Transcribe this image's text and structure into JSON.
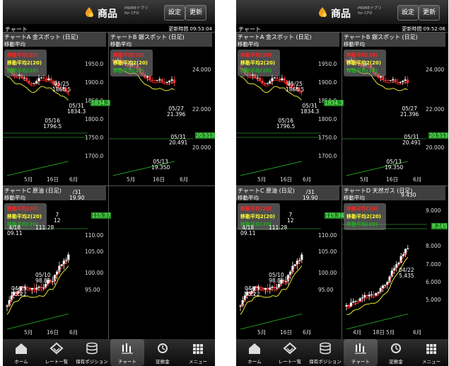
{
  "screens": [
    {
      "header": {
        "title": "商品",
        "sub1": "PRIMEナブリ",
        "sub2": "for CFD",
        "settings_label": "設定",
        "refresh_label": "更新"
      },
      "tab_title": "チャート",
      "updated": "更新時間 09:53:04",
      "panels": [
        {
          "title": "チャートA 金スポット (日足)",
          "subtitle": "移動平均",
          "legend": [
            "移動平均(20)",
            "移動平均2(20)",
            "移動平均(20)"
          ],
          "yticks": [
            "1950.0",
            "1900.0",
            "1850.0",
            "1800.0",
            "1750.0",
            "1700.0"
          ],
          "xticks": [
            "5月",
            "16日",
            "6月"
          ],
          "current": "1834.3",
          "annotations": [
            {
              "text": "05/25\n1866.5"
            },
            {
              "text": "05/31\n1834.3"
            },
            {
              "text": "05/16\n1796.5"
            }
          ]
        },
        {
          "title": "チャートB 銀スポット (日足)",
          "subtitle": "移動平均",
          "legend": [
            "移動平均(20)",
            "移動平均2(20)",
            "移動平均(20)"
          ],
          "yticks": [
            "24.000",
            "22.000",
            "20.000"
          ],
          "xticks": [
            "5月",
            "16日",
            "6月"
          ],
          "current": "20.513",
          "annotations": [
            {
              "text": "05/27\n21.396"
            },
            {
              "text": "05/31\n20.491"
            },
            {
              "text": "05/13\n19.350"
            }
          ]
        },
        {
          "title": "チャートC 原油 (日足)",
          "subtitle": "移動平均",
          "legend": [
            "移動平均(20)",
            "移動平均2(20)",
            "移動平均(20)"
          ],
          "yticks": [
            "110.00",
            "105.00",
            "100.00",
            "95.00"
          ],
          "xticks": [
            "5月",
            "16日",
            "6月"
          ],
          "current": "115.37",
          "annotations": [
            {
              "text": "/31\n19.90"
            },
            {
              "text": "7\n12"
            },
            {
              "text": "4/18\n09.11"
            },
            {
              "text": "111.28"
            },
            {
              "text": "05/10\n98.86"
            },
            {
              "text": "04/25\n95.22"
            }
          ]
        },
        {
          "title": "",
          "subtitle": "",
          "legend": [],
          "yticks": [],
          "xticks": [],
          "current": "",
          "annotations": []
        }
      ]
    },
    {
      "header": {
        "title": "商品",
        "sub1": "PRIMEナブリ",
        "sub2": "for CFD",
        "settings_label": "設定",
        "refresh_label": "更新"
      },
      "tab_title": "チャート",
      "updated": "更新時間 09:52:06",
      "panels": [
        {
          "title": "チャートA 金スポット (日足)",
          "subtitle": "移動平均",
          "legend": [
            "移動平均(20)",
            "移動平均2(20)",
            "移動平均(20)"
          ],
          "yticks": [
            "1950.0",
            "1900.0",
            "1850.0",
            "1800.0",
            "1750.0",
            "1700.0"
          ],
          "xticks": [
            "5月",
            "16日",
            "6月"
          ],
          "current": "1834.3",
          "annotations": [
            {
              "text": "05/25\n1866.5"
            },
            {
              "text": "05/31\n1834.3"
            },
            {
              "text": "05/16\n1796.5"
            }
          ]
        },
        {
          "title": "チャートB 銀スポット (日足)",
          "subtitle": "移動平均",
          "legend": [
            "移動平均(20)",
            "移動平均2(20)",
            "移動平均(20)"
          ],
          "yticks": [
            "24.000",
            "22.000",
            "20.000"
          ],
          "xticks": [
            "5月",
            "16日",
            "6月"
          ],
          "current": "20.513",
          "annotations": [
            {
              "text": "05/27\n21.396"
            },
            {
              "text": "05/31\n20.491"
            },
            {
              "text": "05/13\n19.350"
            }
          ]
        },
        {
          "title": "チャートC 原油 (日足)",
          "subtitle": "移動平均",
          "legend": [
            "移動平均(20)",
            "移動平均2(20)",
            "移動平均(20)"
          ],
          "yticks": [
            "110.00",
            "105.00",
            "100.00",
            "95.00"
          ],
          "xticks": [
            "5月",
            "16日",
            "6月"
          ],
          "current": "115.34",
          "annotations": [
            {
              "text": "/31\n19.90"
            },
            {
              "text": "7\n12"
            },
            {
              "text": "4/18\n09.11"
            },
            {
              "text": "111.28"
            },
            {
              "text": "05/10\n98.86"
            },
            {
              "text": "04/25\n95.22"
            }
          ]
        },
        {
          "title": "チャートD 天然ガス (日足)",
          "subtitle": "移動平均",
          "legend": [
            "移動平均(20)",
            "移動平均2(20)",
            "移動平均(20)"
          ],
          "yticks": [
            "9.000",
            "8.000",
            "7.000",
            "6.000",
            "5.000"
          ],
          "xticks": [
            "4月",
            "18日",
            "5月",
            "6月"
          ],
          "current": "8.245",
          "annotations": [
            {
              "text": "9.430"
            },
            {
              "text": "04/22\n5.435"
            }
          ]
        }
      ]
    }
  ],
  "nav": [
    "ホーム",
    "レート一覧",
    "保有ポジション",
    "チャート",
    "証拠金",
    "メニュー"
  ],
  "colors": {
    "candle_up": "#ffffff",
    "candle_down": "#ff3333",
    "ma1": "#ff2222",
    "ma2": "#ffff33",
    "ma3": "#22aa22",
    "current_bg": "#1f8a1f"
  }
}
